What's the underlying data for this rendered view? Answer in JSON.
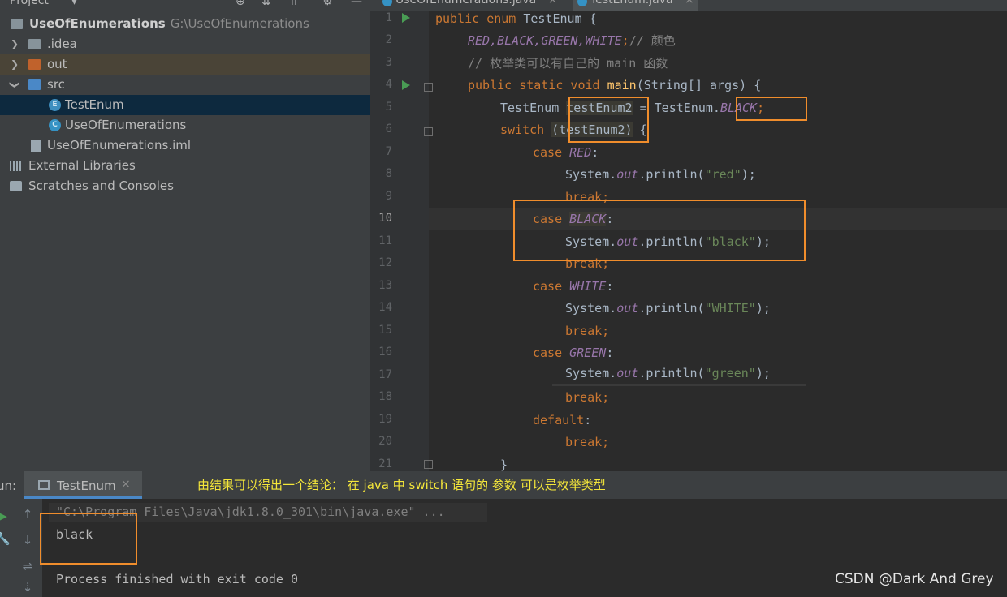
{
  "project_panel": {
    "title": "Project",
    "tree": [
      {
        "label": "UseOfEnumerations",
        "path": "G:\\UseOfEnumerations"
      },
      {
        "label": ".idea"
      },
      {
        "label": "out"
      },
      {
        "label": "src"
      },
      {
        "label": "TestEnum",
        "icon_letter": "E"
      },
      {
        "label": "UseOfEnumerations",
        "icon_letter": "C"
      },
      {
        "label": "UseOfEnumerations.iml"
      },
      {
        "label": "External Libraries"
      },
      {
        "label": "Scratches and Consoles"
      }
    ]
  },
  "editor": {
    "tabs": [
      {
        "label": "UseOfEnumerations.java"
      },
      {
        "label": "TestEnum.java"
      }
    ],
    "tab_close": "×",
    "line_numbers": [
      "1",
      "2",
      "3",
      "4",
      "5",
      "6",
      "7",
      "8",
      "9",
      "10",
      "11",
      "12",
      "13",
      "14",
      "15",
      "16",
      "17",
      "18",
      "19",
      "20",
      "21"
    ],
    "current_line": "10",
    "code": {
      "l1": {
        "kw": "public enum ",
        "name": "TestEnum {"
      },
      "l2": {
        "consts": "RED,BLACK,GREEN,WHITE",
        "semi": ";",
        "comment": "// 颜色"
      },
      "l3": {
        "comment": "// 枚举类可以有自己的 main 函数"
      },
      "l4": {
        "kw": "public static void ",
        "fn": "main",
        "rest": "(String[] args) {"
      },
      "l5": {
        "type": "TestEnum ",
        "var": "testEnum2",
        "eq": " = TestEnum.",
        "const": "BLACK",
        "semi": ";"
      },
      "l6": {
        "kw": "switch ",
        "cond": "(testEnum2)",
        "brace": " {"
      },
      "l7": {
        "kw": "case ",
        "const": "RED",
        "colon": ":"
      },
      "l8": {
        "pre": "System.",
        "out": "out",
        "mid": ".println(",
        "str": "\"red\"",
        "end": ");"
      },
      "l9": {
        "kw": "break;"
      },
      "l10": {
        "kw": "case ",
        "const": "BLACK",
        "colon": ":"
      },
      "l11": {
        "pre": "System.",
        "out": "out",
        "mid": ".println(",
        "str": "\"black\"",
        "end": ");"
      },
      "l12": {
        "kw": "break;"
      },
      "l13": {
        "kw": "case ",
        "const": "WHITE",
        "colon": ":"
      },
      "l14": {
        "pre": "System.",
        "out": "out",
        "mid": ".println(",
        "str": "\"WHITE\"",
        "end": ");"
      },
      "l15": {
        "kw": "break;"
      },
      "l16": {
        "kw": "case ",
        "const": "GREEN",
        "colon": ":"
      },
      "l17": {
        "pre": "System.",
        "out": "out",
        "mid": ".println(",
        "str": "\"green\"",
        "end": ");"
      },
      "l18": {
        "kw": "break;"
      },
      "l19": {
        "kw": "default",
        "colon": ":"
      },
      "l20": {
        "kw": "break;"
      },
      "l21": {
        "brace": "}"
      }
    }
  },
  "run_panel": {
    "label": "un:",
    "tab": "TestEnum",
    "tab_close": "×",
    "annotation": "由结果可以得出一个结论： 在 java 中 switch 语句的 参数 可以是枚举类型",
    "console": {
      "command": "\"C:\\Program Files\\Java\\jdk1.8.0_301\\bin\\java.exe\" ...",
      "output": "black",
      "finished": "Process finished with exit code 0"
    }
  },
  "watermark": "CSDN @Dark And Grey",
  "colors": {
    "highlight_box": "#f08d2c",
    "annotation": "#f5e73a",
    "keyword": "#cc7832",
    "enum_const": "#9876aa",
    "string": "#6a8759"
  }
}
